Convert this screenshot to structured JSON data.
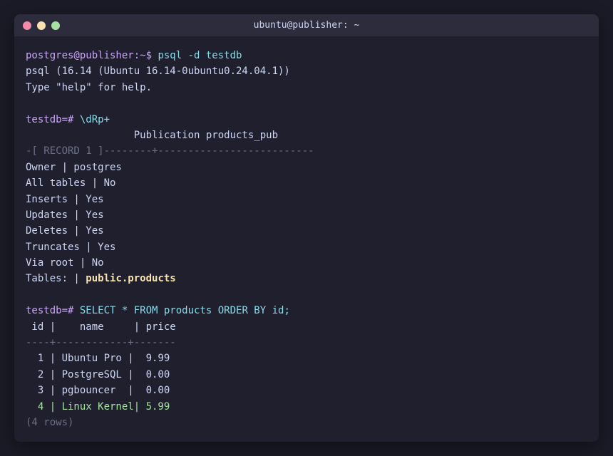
{
  "window": {
    "title": "ubuntu@publisher: ~"
  },
  "terminal": {
    "prompt1": "postgres@publisher:~$",
    "cmd1": " psql -d testdb",
    "version_line": "psql (16.14 (Ubuntu 16.14-0ubuntu0.24.04.1))",
    "help_line": "Type \"help\" for help.",
    "prompt2": "testdb=#",
    "cmd2": " \\dRp+",
    "pub_header": "                  Publication products_pub",
    "record_sep": "-[ RECORD 1 ]--------+--------------------------",
    "record_rows": [
      "Owner | postgres",
      "All tables | No",
      "Inserts | Yes",
      "Updates | Yes",
      "Deletes | Yes",
      "Truncates | Yes",
      "Via root | No"
    ],
    "tables_label": "Tables: | ",
    "tables_value": "public.products",
    "prompt3": "testdb=#",
    "cmd3": " SELECT * FROM products ORDER BY id;",
    "result_header": " id |    name     | price",
    "result_sep": "----+------------+-------",
    "result_rows": [
      "  1 | Ubuntu Pro |  9.99",
      "  2 | PostgreSQL |  0.00",
      "  3 | pgbouncer  |  0.00"
    ],
    "highlight_row": "  4 | Linux Kernel| 5.99",
    "row_count": "(4 rows)"
  },
  "colors": {
    "background": "#1f1f2e",
    "titlebar": "#2c2c3d",
    "text": "#cdd6f4",
    "prompt": "#cba6f7",
    "command": "#89dceb",
    "dim": "#6c7086",
    "highlight": "#f9e2af",
    "new_row": "#a6e3a1"
  }
}
